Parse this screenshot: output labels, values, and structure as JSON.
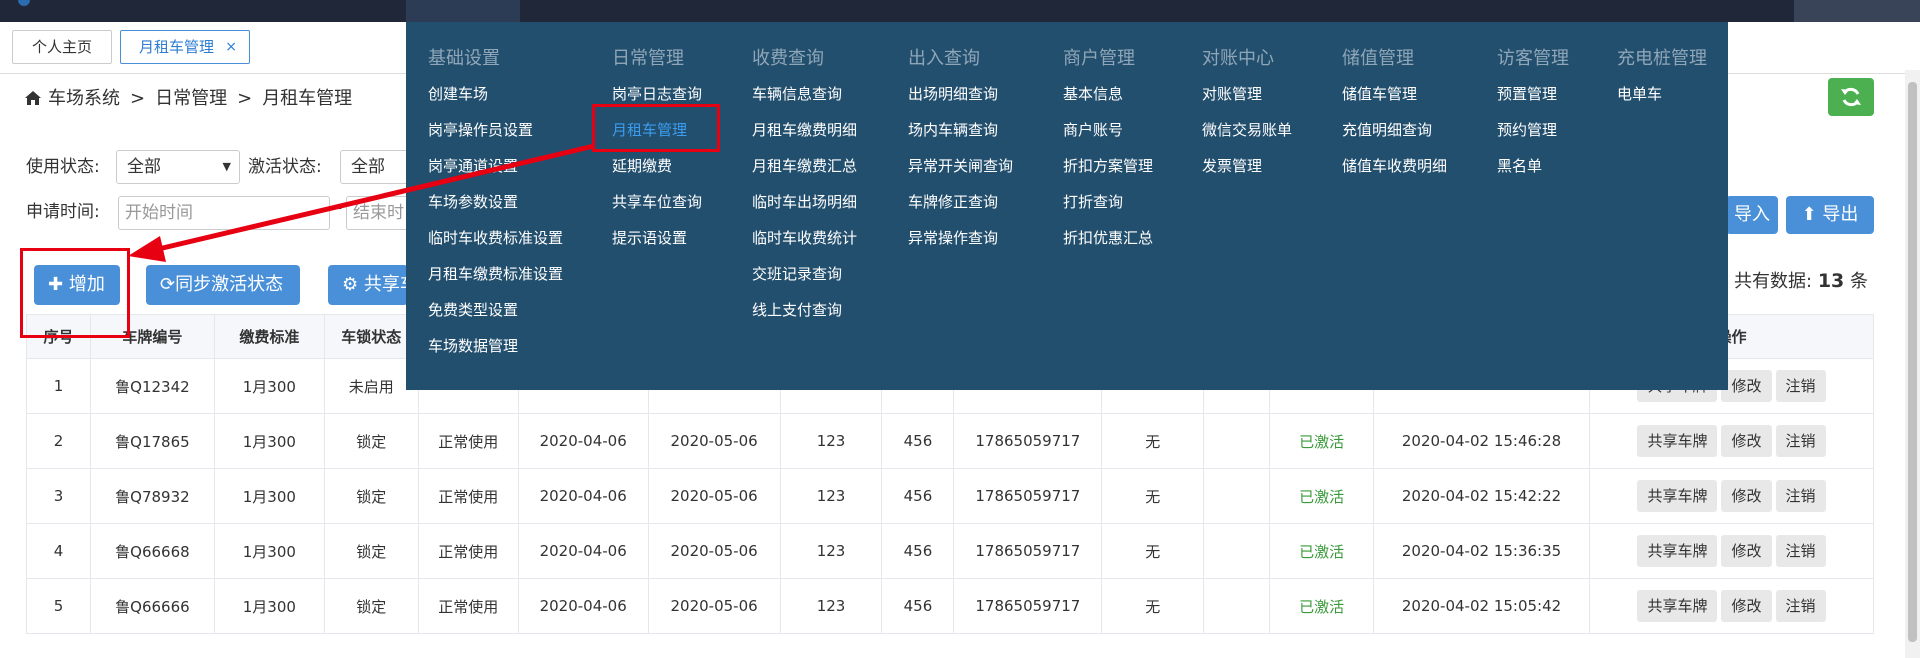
{
  "tabs": {
    "home": "个人主页",
    "active": "月租车管理",
    "close": "×"
  },
  "breadcrumb": {
    "root": "车场系统",
    "sep": ">",
    "level1": "日常管理",
    "level2": "月租车管理"
  },
  "filters": {
    "status_label": "使用状态:",
    "status_value": "全部",
    "activate_label": "激活状态:",
    "activate_value": "全部",
    "apply_time_label": "申请时间:",
    "start_placeholder": "开始时间",
    "end_placeholder": "结束时",
    "dash": "-"
  },
  "buttons": {
    "import": "导入",
    "export": "导出",
    "add": "增加",
    "sync": "同步激活状态",
    "share": "共享车"
  },
  "total": {
    "prefix": "共有数据:",
    "count": "13",
    "suffix": "条"
  },
  "table": {
    "headers": [
      "序号",
      "车牌编号",
      "缴费标准",
      "车锁状态",
      "",
      "",
      "",
      "",
      "",
      "",
      "",
      "",
      "",
      "",
      "操作"
    ],
    "rows": [
      [
        "1",
        "鲁Q12342",
        "1月300",
        "未启用",
        "",
        "",
        "",
        "",
        "",
        "",
        "",
        "",
        "",
        ""
      ],
      [
        "2",
        "鲁Q17865",
        "1月300",
        "锁定",
        "正常使用",
        "2020-04-06",
        "2020-05-06",
        "123",
        "456",
        "17865059717",
        "无",
        "",
        "已激活",
        "2020-04-02 15:46:28"
      ],
      [
        "3",
        "鲁Q78932",
        "1月300",
        "锁定",
        "正常使用",
        "2020-04-06",
        "2020-05-06",
        "123",
        "456",
        "17865059717",
        "无",
        "",
        "已激活",
        "2020-04-02 15:42:22"
      ],
      [
        "4",
        "鲁Q66668",
        "1月300",
        "锁定",
        "正常使用",
        "2020-04-06",
        "2020-05-06",
        "123",
        "456",
        "17865059717",
        "无",
        "",
        "已激活",
        "2020-04-02 15:36:35"
      ],
      [
        "5",
        "鲁Q66666",
        "1月300",
        "锁定",
        "正常使用",
        "2020-04-06",
        "2020-05-06",
        "123",
        "456",
        "17865059717",
        "无",
        "",
        "已激活",
        "2020-04-02 15:05:42"
      ]
    ],
    "actions": {
      "share": "共享车牌",
      "edit": "修改",
      "cancel": "注销"
    }
  },
  "menu": {
    "columns": [
      {
        "head": "基础设置",
        "items": [
          "创建车场",
          "岗亭操作员设置",
          "岗亭通道设置",
          "车场参数设置",
          "临时车收费标准设置",
          "月租车缴费标准设置",
          "免费类型设置",
          "车场数据管理"
        ]
      },
      {
        "head": "日常管理",
        "items": [
          "岗亭日志查询",
          "月租车管理",
          "延期缴费",
          "共享车位查询",
          "提示语设置"
        ]
      },
      {
        "head": "收费查询",
        "items": [
          "车辆信息查询",
          "月租车缴费明细",
          "月租车缴费汇总",
          "临时车出场明细",
          "临时车收费统计",
          "交班记录查询",
          "线上支付查询"
        ]
      },
      {
        "head": "出入查询",
        "items": [
          "出场明细查询",
          "场内车辆查询",
          "异常开关闸查询",
          "车牌修正查询",
          "异常操作查询"
        ]
      },
      {
        "head": "商户管理",
        "items": [
          "基本信息",
          "商户账号",
          "折扣方案管理",
          "打折查询",
          "折扣优惠汇总"
        ]
      },
      {
        "head": "对账中心",
        "items": [
          "对账管理",
          "微信交易账单",
          "发票管理"
        ]
      },
      {
        "head": "储值管理",
        "items": [
          "储值车管理",
          "充值明细查询",
          "储值车收费明细"
        ]
      },
      {
        "head": "访客管理",
        "items": [
          "预置管理",
          "预约管理",
          "黑名单"
        ]
      },
      {
        "head": "充电桩管理",
        "items": [
          "电单车"
        ]
      }
    ]
  },
  "colors": {
    "menu_bg": "#234f6e",
    "active_link": "#3b9cf0",
    "annotation": "#e60012",
    "primary": "#4a90d9",
    "success": "#3a9a3a"
  }
}
